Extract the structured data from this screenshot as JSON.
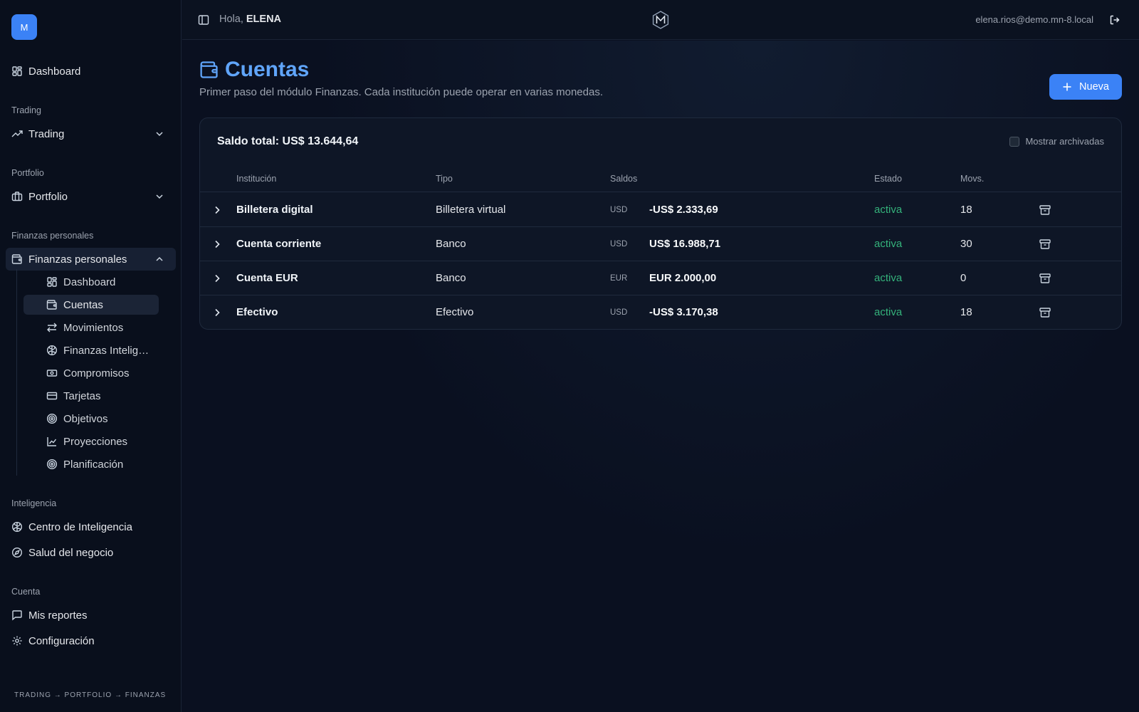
{
  "colors": {
    "accent": "#3b82f6",
    "title": "#60a5fa",
    "status_active": "#34b27b",
    "background": "#0a1020"
  },
  "sidebar": {
    "logo_letter": "M",
    "dashboard": "Dashboard",
    "sections": {
      "trading": "Trading",
      "portfolio": "Portfolio",
      "finanzas": "Finanzas personales",
      "inteligencia": "Inteligencia",
      "cuenta": "Cuenta"
    },
    "groups": {
      "trading": "Trading",
      "portfolio": "Portfolio",
      "finanzas": "Finanzas personales"
    },
    "finanzas_items": [
      {
        "label": "Dashboard",
        "icon": "dashboard-icon"
      },
      {
        "label": "Cuentas",
        "icon": "wallet-icon"
      },
      {
        "label": "Movimientos",
        "icon": "arrows-icon"
      },
      {
        "label": "Finanzas Inteligentes",
        "icon": "brain-icon"
      },
      {
        "label": "Compromisos",
        "icon": "banknote-icon"
      },
      {
        "label": "Tarjetas",
        "icon": "credit-card-icon"
      },
      {
        "label": "Objetivos",
        "icon": "target-icon"
      },
      {
        "label": "Proyecciones",
        "icon": "line-chart-icon"
      },
      {
        "label": "Planificación",
        "icon": "target-icon"
      }
    ],
    "inteligencia_items": [
      "Centro de Inteligencia",
      "Salud del negocio"
    ],
    "cuenta_items": [
      "Mis reportes",
      "Configuración"
    ],
    "footer_breadcrumb": "TRADING → PORTFOLIO → FINANZAS"
  },
  "topbar": {
    "greeting_prefix": "Hola,",
    "user_name": "ELENA",
    "email": "elena.rios@demo.mn-8.local"
  },
  "main": {
    "title": "Cuentas",
    "subtitle": "Primer paso del módulo Finanzas. Cada institución puede operar en varias monedas.",
    "new_button": "Nueva",
    "total_balance": "Saldo total: US$ 13.644,64",
    "show_archived": "Mostrar archivadas",
    "columns": [
      "Institución",
      "Tipo",
      "Saldos",
      "Estado",
      "Movs."
    ],
    "rows": [
      {
        "institution": "Billetera digital",
        "type": "Billetera virtual",
        "currency": "USD",
        "balance": "-US$ 2.333,69",
        "status": "activa",
        "movs": "18"
      },
      {
        "institution": "Cuenta corriente",
        "type": "Banco",
        "currency": "USD",
        "balance": "US$ 16.988,71",
        "status": "activa",
        "movs": "30"
      },
      {
        "institution": "Cuenta EUR",
        "type": "Banco",
        "currency": "EUR",
        "balance": "EUR 2.000,00",
        "status": "activa",
        "movs": "0"
      },
      {
        "institution": "Efectivo",
        "type": "Efectivo",
        "currency": "USD",
        "balance": "-US$ 3.170,38",
        "status": "activa",
        "movs": "18"
      }
    ]
  }
}
